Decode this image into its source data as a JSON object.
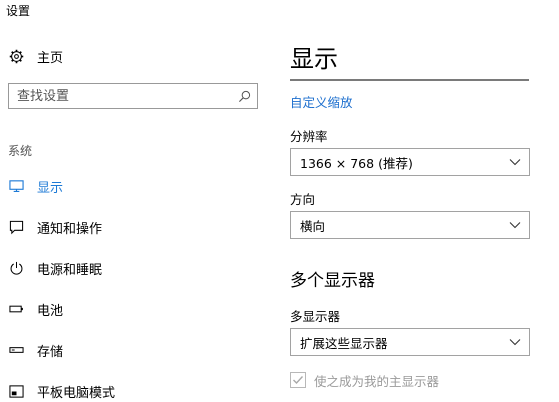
{
  "window": {
    "title": "设置"
  },
  "sidebar": {
    "home_label": "主页",
    "search_placeholder": "查找设置",
    "section_label": "系统",
    "items": [
      {
        "label": "显示",
        "icon": "monitor-icon",
        "active": true
      },
      {
        "label": "通知和操作",
        "icon": "notification-icon",
        "active": false
      },
      {
        "label": "电源和睡眠",
        "icon": "power-icon",
        "active": false
      },
      {
        "label": "电池",
        "icon": "battery-icon",
        "active": false
      },
      {
        "label": "存储",
        "icon": "storage-icon",
        "active": false
      },
      {
        "label": "平板电脑模式",
        "icon": "tablet-mode-icon",
        "active": false
      }
    ]
  },
  "main": {
    "title": "显示",
    "custom_scaling_link": "自定义缩放",
    "resolution": {
      "label": "分辨率",
      "value": "1366 × 768 (推荐)"
    },
    "orientation": {
      "label": "方向",
      "value": "横向"
    },
    "multiple_displays": {
      "heading": "多个显示器",
      "label": "多显示器",
      "value": "扩展这些显示器",
      "main_display_checkbox": {
        "label": "使之成为我的主显示器",
        "checked": true,
        "disabled": true
      }
    }
  },
  "colors": {
    "accent": "#1d7ad6",
    "link": "#1d6fce",
    "disabled_text": "#9a9a9a",
    "border": "#a2a2a2"
  }
}
